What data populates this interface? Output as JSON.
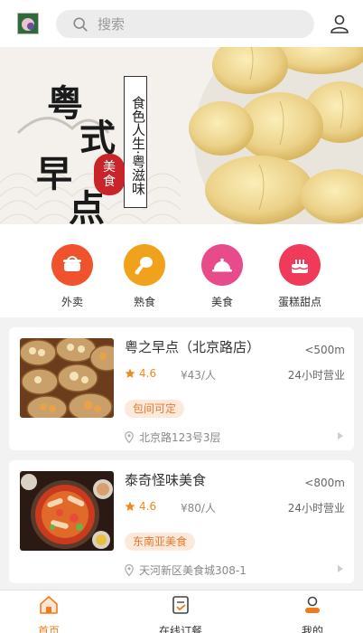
{
  "header": {
    "search_placeholder": "搜索"
  },
  "banner": {
    "title_chars": [
      "粤",
      "式",
      "早",
      "点"
    ],
    "slogan": "食色人生·粤滋味",
    "seal": [
      "美",
      "食"
    ]
  },
  "categories": [
    {
      "label": "外卖",
      "icon": "takeout-icon",
      "color": "#f0522e"
    },
    {
      "label": "熟食",
      "icon": "drumstick-icon",
      "color": "#f0a21c"
    },
    {
      "label": "美食",
      "icon": "cloche-icon",
      "color": "#e84b8a"
    },
    {
      "label": "蛋糕甜点",
      "icon": "cake-icon",
      "color": "#f03a5a"
    }
  ],
  "restaurants": [
    {
      "name": "粤之早点（北京路店）",
      "distance": "<500m",
      "rating": "4.6",
      "price": "¥43/人",
      "hours": "24小时营业",
      "tag": "包间可定",
      "address": "北京路123号3层"
    },
    {
      "name": "泰奇怪味美食",
      "distance": "<800m",
      "rating": "4.6",
      "price": "¥80/人",
      "hours": "24小时营业",
      "tag": "东南亚美食",
      "address": "天河新区美食城308-1"
    }
  ],
  "tabbar": [
    {
      "label": "首页",
      "active": true
    },
    {
      "label": "在线订餐",
      "active": false
    },
    {
      "label": "我的",
      "active": false
    }
  ],
  "colors": {
    "accent": "#f07b1d",
    "rating": "#f08a1c",
    "tag_bg": "#fde9dc",
    "seal": "#c9242a"
  }
}
